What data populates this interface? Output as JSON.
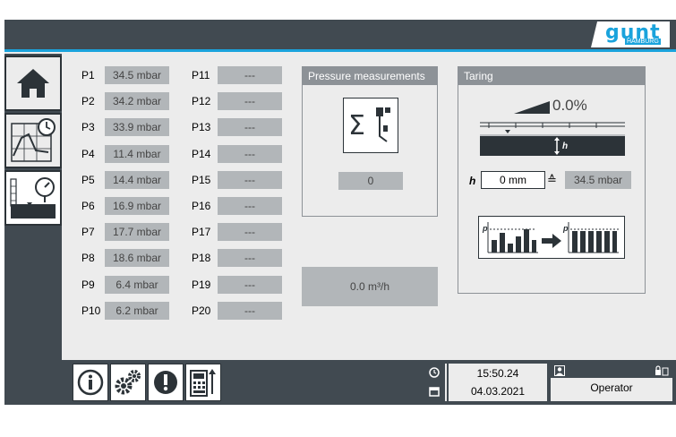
{
  "logo": {
    "text": "gunt",
    "sub": "HAMBURG"
  },
  "pressures_left": [
    {
      "label": "P1",
      "value": "34.5 mbar"
    },
    {
      "label": "P2",
      "value": "34.2 mbar"
    },
    {
      "label": "P3",
      "value": "33.9 mbar"
    },
    {
      "label": "P4",
      "value": "11.4 mbar"
    },
    {
      "label": "P5",
      "value": "14.4 mbar"
    },
    {
      "label": "P6",
      "value": "16.9 mbar"
    },
    {
      "label": "P7",
      "value": "17.7 mbar"
    },
    {
      "label": "P8",
      "value": "18.6 mbar"
    },
    {
      "label": "P9",
      "value": "6.4 mbar"
    },
    {
      "label": "P10",
      "value": "6.2 mbar"
    }
  ],
  "pressures_right": [
    {
      "label": "P11",
      "value": "---"
    },
    {
      "label": "P12",
      "value": "---"
    },
    {
      "label": "P13",
      "value": "---"
    },
    {
      "label": "P14",
      "value": "---"
    },
    {
      "label": "P15",
      "value": "---"
    },
    {
      "label": "P16",
      "value": "---"
    },
    {
      "label": "P17",
      "value": "---"
    },
    {
      "label": "P18",
      "value": "---"
    },
    {
      "label": "P19",
      "value": "---"
    },
    {
      "label": "P20",
      "value": "---"
    }
  ],
  "pressure_panel": {
    "title": "Pressure measurements",
    "count": "0"
  },
  "flow": {
    "value": "0.0 m³/h"
  },
  "taring": {
    "title": "Taring",
    "slope": "0.0%",
    "h_label": "h",
    "h_value": "0 mm",
    "equiv": "≙",
    "h_pressure": "34.5 mbar"
  },
  "status": {
    "time": "15:50.24",
    "date": "04.03.2021",
    "user": "Operator"
  },
  "colors": {
    "accent": "#1aa3dc",
    "dark": "#414a51",
    "panel": "#8d9297",
    "field": "#b2b6b9"
  }
}
